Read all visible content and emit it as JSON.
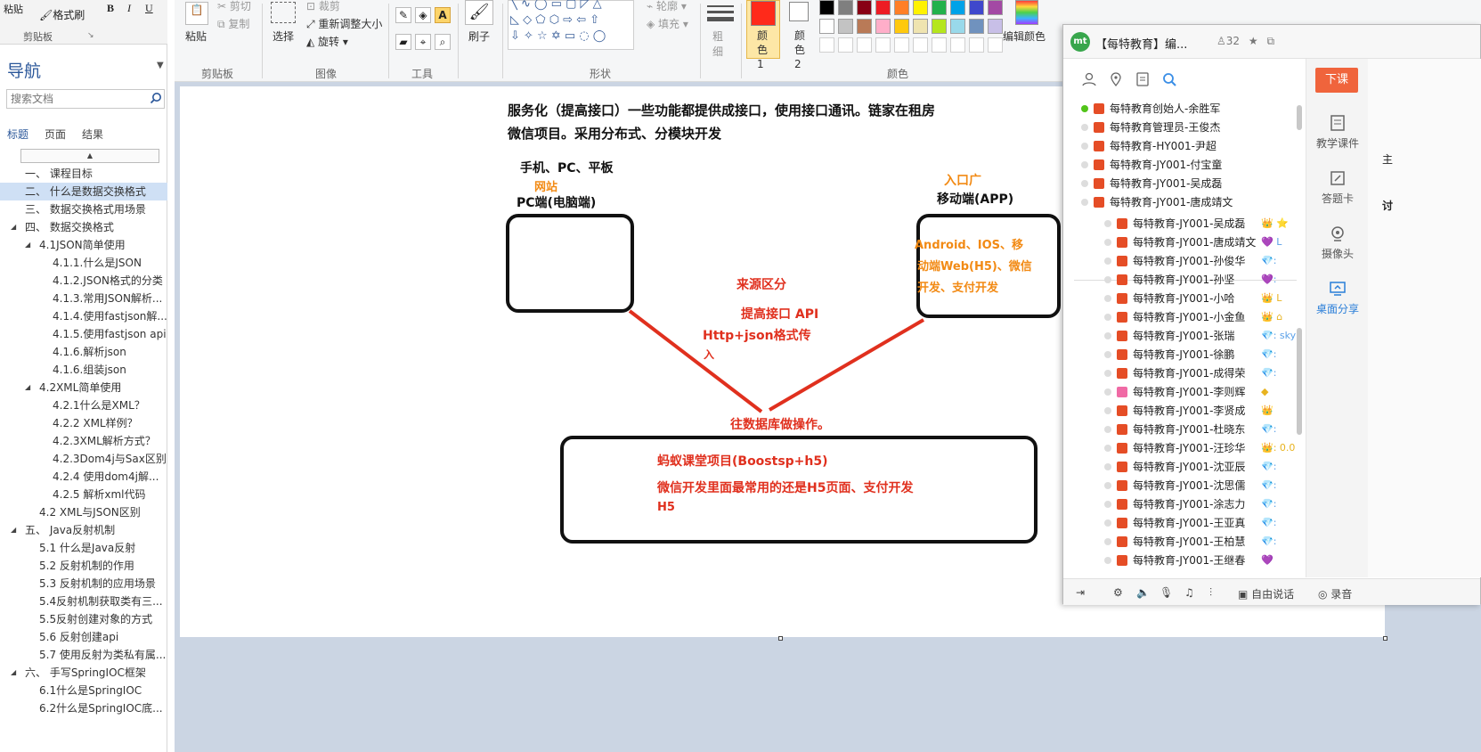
{
  "word": {
    "ribbon": {
      "paste_label": "粘贴",
      "format_painter_label": "格式刷",
      "bold": "B",
      "italic": "I",
      "underline": "U",
      "clipboard_group": "剪贴板"
    },
    "nav": {
      "title": "导航",
      "search_placeholder": "搜索文档",
      "tabs": [
        "标题",
        "页面",
        "结果"
      ],
      "items": [
        {
          "text": "一、 课程目标",
          "indent": 28,
          "tri": ""
        },
        {
          "text": "二、 什么是数据交换格式",
          "indent": 28,
          "tri": "",
          "selected": true
        },
        {
          "text": "三、 数据交换格式用场景",
          "indent": 28,
          "tri": ""
        },
        {
          "text": "四、 数据交换格式",
          "indent": 28,
          "tri": "◢"
        },
        {
          "text": "4.1JSON简单使用",
          "indent": 44,
          "tri": "◢"
        },
        {
          "text": "4.1.1.什么是JSON",
          "indent": 59,
          "tri": ""
        },
        {
          "text": "4.1.2.JSON格式的分类",
          "indent": 59,
          "tri": ""
        },
        {
          "text": "4.1.3.常用JSON解析...",
          "indent": 59,
          "tri": ""
        },
        {
          "text": "4.1.4.使用fastjson解...",
          "indent": 59,
          "tri": ""
        },
        {
          "text": "4.1.5.使用fastjson api",
          "indent": 59,
          "tri": ""
        },
        {
          "text": "4.1.6.解析json",
          "indent": 59,
          "tri": ""
        },
        {
          "text": "4.1.6.组装json",
          "indent": 59,
          "tri": ""
        },
        {
          "text": "4.2XML简单使用",
          "indent": 44,
          "tri": "◢"
        },
        {
          "text": "4.2.1什么是XML？",
          "indent": 59,
          "tri": ""
        },
        {
          "text": "4.2.2 XML样例？",
          "indent": 59,
          "tri": ""
        },
        {
          "text": "4.2.3XML解析方式？",
          "indent": 59,
          "tri": ""
        },
        {
          "text": "4.2.3Dom4j与Sax区别",
          "indent": 59,
          "tri": ""
        },
        {
          "text": "4.2.4 使用dom4j解...",
          "indent": 59,
          "tri": ""
        },
        {
          "text": "4.2.5 解析xml代码",
          "indent": 59,
          "tri": ""
        },
        {
          "text": "4.2 XML与JSON区别",
          "indent": 44,
          "tri": ""
        },
        {
          "text": "五、 Java反射机制",
          "indent": 28,
          "tri": "◢"
        },
        {
          "text": "5.1 什么是Java反射",
          "indent": 44,
          "tri": ""
        },
        {
          "text": "5.2 反射机制的作用",
          "indent": 44,
          "tri": ""
        },
        {
          "text": "5.3 反射机制的应用场景",
          "indent": 44,
          "tri": ""
        },
        {
          "text": "5.4反射机制获取类有三...",
          "indent": 44,
          "tri": ""
        },
        {
          "text": "5.5反射创建对象的方式",
          "indent": 44,
          "tri": ""
        },
        {
          "text": "5.6 反射创建api",
          "indent": 44,
          "tri": ""
        },
        {
          "text": "5.7 使用反射为类私有属...",
          "indent": 44,
          "tri": ""
        },
        {
          "text": "六、 手写SpringIOC框架",
          "indent": 28,
          "tri": "◢"
        },
        {
          "text": "6.1什么是SpringIOC",
          "indent": 44,
          "tri": ""
        },
        {
          "text": "6.2什么是SpringIOC底...",
          "indent": 44,
          "tri": ""
        }
      ]
    }
  },
  "paint": {
    "ribbon": {
      "paste": "粘贴",
      "cut": "剪切",
      "copy": "复制",
      "clipboard_group": "剪贴板",
      "select": "选择",
      "crop": "裁剪",
      "resize": "重新调整大小",
      "rotate": "旋转",
      "image_group": "图像",
      "tools_group": "工具",
      "brush": "刷子",
      "shapes_group": "形状",
      "outline": "轮廓",
      "fill": "填充",
      "size": "粗细",
      "color1": "颜色 1",
      "color2": "颜色 2",
      "colors_group": "颜色",
      "edit_colors": "编辑颜色",
      "color1_value": "#ff2a1a",
      "color2_value": "#ffffff",
      "palette": [
        "#000000",
        "#7f7f7f",
        "#880015",
        "#ed1c24",
        "#ff7f27",
        "#fff200",
        "#22b14c",
        "#00a2e8",
        "#3f48cc",
        "#a349a4",
        "#ffffff",
        "#c3c3c3",
        "#b97a57",
        "#ffaec9",
        "#ffc90e",
        "#efe4b0",
        "#b5e61d",
        "#99d9ea",
        "#7092be",
        "#c8bfe7"
      ]
    },
    "canvas": {
      "line1": "服务化（提高接口）一些功能都提供成接口，使用接口通讯。链家在租房",
      "line2": "微信项目。采用分布式、分模块开发",
      "devices": "手机、PC、平板",
      "website": "网站",
      "pc": "PC端(电脑端)",
      "entry": "入口广",
      "mobile": "移动端(APP)",
      "platforms1": "Android、IOS、移",
      "platforms2": "动端Web(H5)、微信",
      "platforms3": "开发、支付开发",
      "source": "来源区分",
      "api": "提高接口 API",
      "http1": "Http+json格式传",
      "http2": "入",
      "db": "往数据库做操作。",
      "project": "蚂蚁课堂项目(Boostsp+h5)",
      "wechat": "微信开发里面最常用的还是H5页面、支付开发",
      "h5": "H5"
    }
  },
  "chat": {
    "title": "【每特教育】编...",
    "logo": "mt",
    "member_count": "32",
    "end_class": "下课",
    "side": [
      "教学课件",
      "答题卡",
      "摄像头",
      "桌面分享"
    ],
    "right_peek": [
      "主",
      "讨"
    ],
    "bottom": {
      "free_talk": "自由说话",
      "record": "录音"
    },
    "admins": [
      {
        "name": "每特教育创始人-余胜军",
        "online": true
      },
      {
        "name": "每特教育管理员-王俊杰",
        "online": false
      },
      {
        "name": "每特教育-HY001-尹超",
        "online": false
      },
      {
        "name": "每特教育-JY001-付宝童",
        "online": false
      },
      {
        "name": "每特教育-JY001-吴成磊",
        "online": false
      },
      {
        "name": "每特教育-JY001-唐成靖文",
        "online": false
      }
    ],
    "members": [
      {
        "name": "每特教育-JY001-吴成磊",
        "extra": "👑 ⭐",
        "cls": "gold"
      },
      {
        "name": "每特教育-JY001-唐成靖文",
        "extra": "💜 L",
        "cls": ""
      },
      {
        "name": "每特教育-JY001-孙俊华",
        "extra": "💎:",
        "cls": ""
      },
      {
        "name": "每特教育-JY001-孙坚",
        "extra": "💜:",
        "cls": ""
      },
      {
        "name": "每特教育-JY001-小哈",
        "extra": "👑 L",
        "cls": "gold"
      },
      {
        "name": "每特教育-JY001-小金鱼",
        "extra": "👑 ⌂",
        "cls": "gold"
      },
      {
        "name": "每特教育-JY001-张瑞",
        "extra": "💎: sky",
        "cls": ""
      },
      {
        "name": "每特教育-JY001-徐鹏",
        "extra": "💎:",
        "cls": ""
      },
      {
        "name": "每特教育-JY001-成得荣",
        "extra": "💎:",
        "cls": ""
      },
      {
        "name": "每特教育-JY001-李则辉",
        "extra": "◆",
        "cls": "gold"
      },
      {
        "name": "每特教育-JY001-李贤成",
        "extra": "👑",
        "cls": "gold"
      },
      {
        "name": "每特教育-JY001-杜晓东",
        "extra": "💎:",
        "cls": ""
      },
      {
        "name": "每特教育-JY001-汪珍华",
        "extra": "👑: 0.0",
        "cls": "gold"
      },
      {
        "name": "每特教育-JY001-沈亚辰",
        "extra": "💎:",
        "cls": ""
      },
      {
        "name": "每特教育-JY001-沈思儒",
        "extra": "💎:",
        "cls": ""
      },
      {
        "name": "每特教育-JY001-涂志力",
        "extra": "💎:",
        "cls": ""
      },
      {
        "name": "每特教育-JY001-王亚真",
        "extra": "💎:",
        "cls": ""
      },
      {
        "name": "每特教育-JY001-王柏慧",
        "extra": "💎:",
        "cls": ""
      },
      {
        "name": "每特教育-JY001-王继春",
        "extra": "💜",
        "cls": ""
      }
    ]
  },
  "icons": {
    "search": "search-icon",
    "user": "user-icon",
    "location": "location-icon",
    "note": "note-icon",
    "star": "star-icon"
  }
}
